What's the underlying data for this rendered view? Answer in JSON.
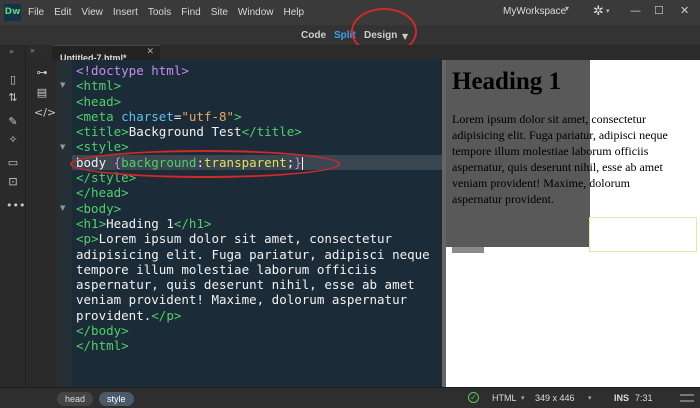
{
  "app": {
    "logo": "Dw",
    "workspace": "MyWorkspace"
  },
  "menu": [
    "File",
    "Edit",
    "View",
    "Insert",
    "Tools",
    "Find",
    "Site",
    "Window",
    "Help"
  ],
  "views": {
    "code": "Code",
    "split": "Split",
    "design": "Design",
    "active": "Split"
  },
  "document": {
    "tab_label": "Untitled-7.html*"
  },
  "code_lines": [
    [
      [
        "kw",
        "<!doctype html>"
      ]
    ],
    [
      [
        "tg",
        "<html>"
      ]
    ],
    [
      [
        "tg",
        "<head>"
      ]
    ],
    [
      [
        "tg",
        "<meta "
      ],
      [
        "at",
        "charset"
      ],
      [
        "txt",
        "="
      ],
      [
        "str",
        "\"utf-8\""
      ],
      [
        "tg",
        ">"
      ]
    ],
    [
      [
        "tg",
        "<title>"
      ],
      [
        "txt",
        "Background Test"
      ],
      [
        "tg",
        "</title>"
      ]
    ],
    [
      [
        "tg",
        "<style>"
      ]
    ],
    [
      [
        "txt",
        "body "
      ],
      [
        "kw",
        "{"
      ],
      [
        "prop",
        "background"
      ],
      [
        "txt",
        ":"
      ],
      [
        "val",
        "transparent"
      ],
      [
        "txt",
        ";"
      ],
      [
        "kw",
        "}"
      ]
    ],
    [
      [
        "tg",
        "</style>"
      ]
    ],
    [
      [
        "tg",
        "</head>"
      ]
    ],
    [
      [
        "tg",
        "<body>"
      ]
    ],
    [
      [
        "tg",
        "<h1>"
      ],
      [
        "txt",
        "Heading 1"
      ],
      [
        "tg",
        "</h1>"
      ]
    ],
    [
      [
        "tg",
        "<p>"
      ],
      [
        "txt",
        "Lorem ipsum dolor sit amet, consectetur"
      ]
    ],
    [
      [
        "txt",
        "adipisicing elit. Fuga pariatur, adipisci neque"
      ]
    ],
    [
      [
        "txt",
        "tempore illum molestiae laborum officiis"
      ]
    ],
    [
      [
        "txt",
        "aspernatur, quis deserunt nihil, esse ab amet"
      ]
    ],
    [
      [
        "txt",
        "veniam provident! Maxime, dolorum aspernatur"
      ]
    ],
    [
      [
        "txt",
        "provident."
      ],
      [
        "tg",
        "</p>"
      ]
    ],
    [
      [
        "tg",
        "</body>"
      ]
    ],
    [
      [
        "tg",
        "</html>"
      ]
    ]
  ],
  "design": {
    "heading": "Heading 1",
    "paragraph_lines": [
      "Lorem ipsum dolor sit amet, consectetur",
      "adipisicing elit. Fuga pariatur, adipisci neque",
      "tempore illum molestiae laborum officiis",
      "aspernatur, quis deserunt nihil, esse ab amet",
      "veniam provident! Maxime, dolorum",
      "aspernatur provident."
    ]
  },
  "status": {
    "breadcrumbs": [
      "head",
      "style"
    ],
    "doctype": "HTML",
    "dimensions": "349 x 446",
    "insert_mode": "INS",
    "cursor_pos": "7:31"
  },
  "icons": {
    "left_toolbar": [
      "file-icon",
      "swap-icon",
      "brush-icon",
      "code-hint-icon",
      "chat-icon",
      "comment-icon",
      "more-icon"
    ],
    "gutter": [
      "dom-tree-icon",
      "inspect-icon",
      "code-tag-icon"
    ]
  },
  "colors": {
    "active_view": "#3da1e8",
    "annotation": "#d12828",
    "editor_bg": "#1b2b38"
  }
}
